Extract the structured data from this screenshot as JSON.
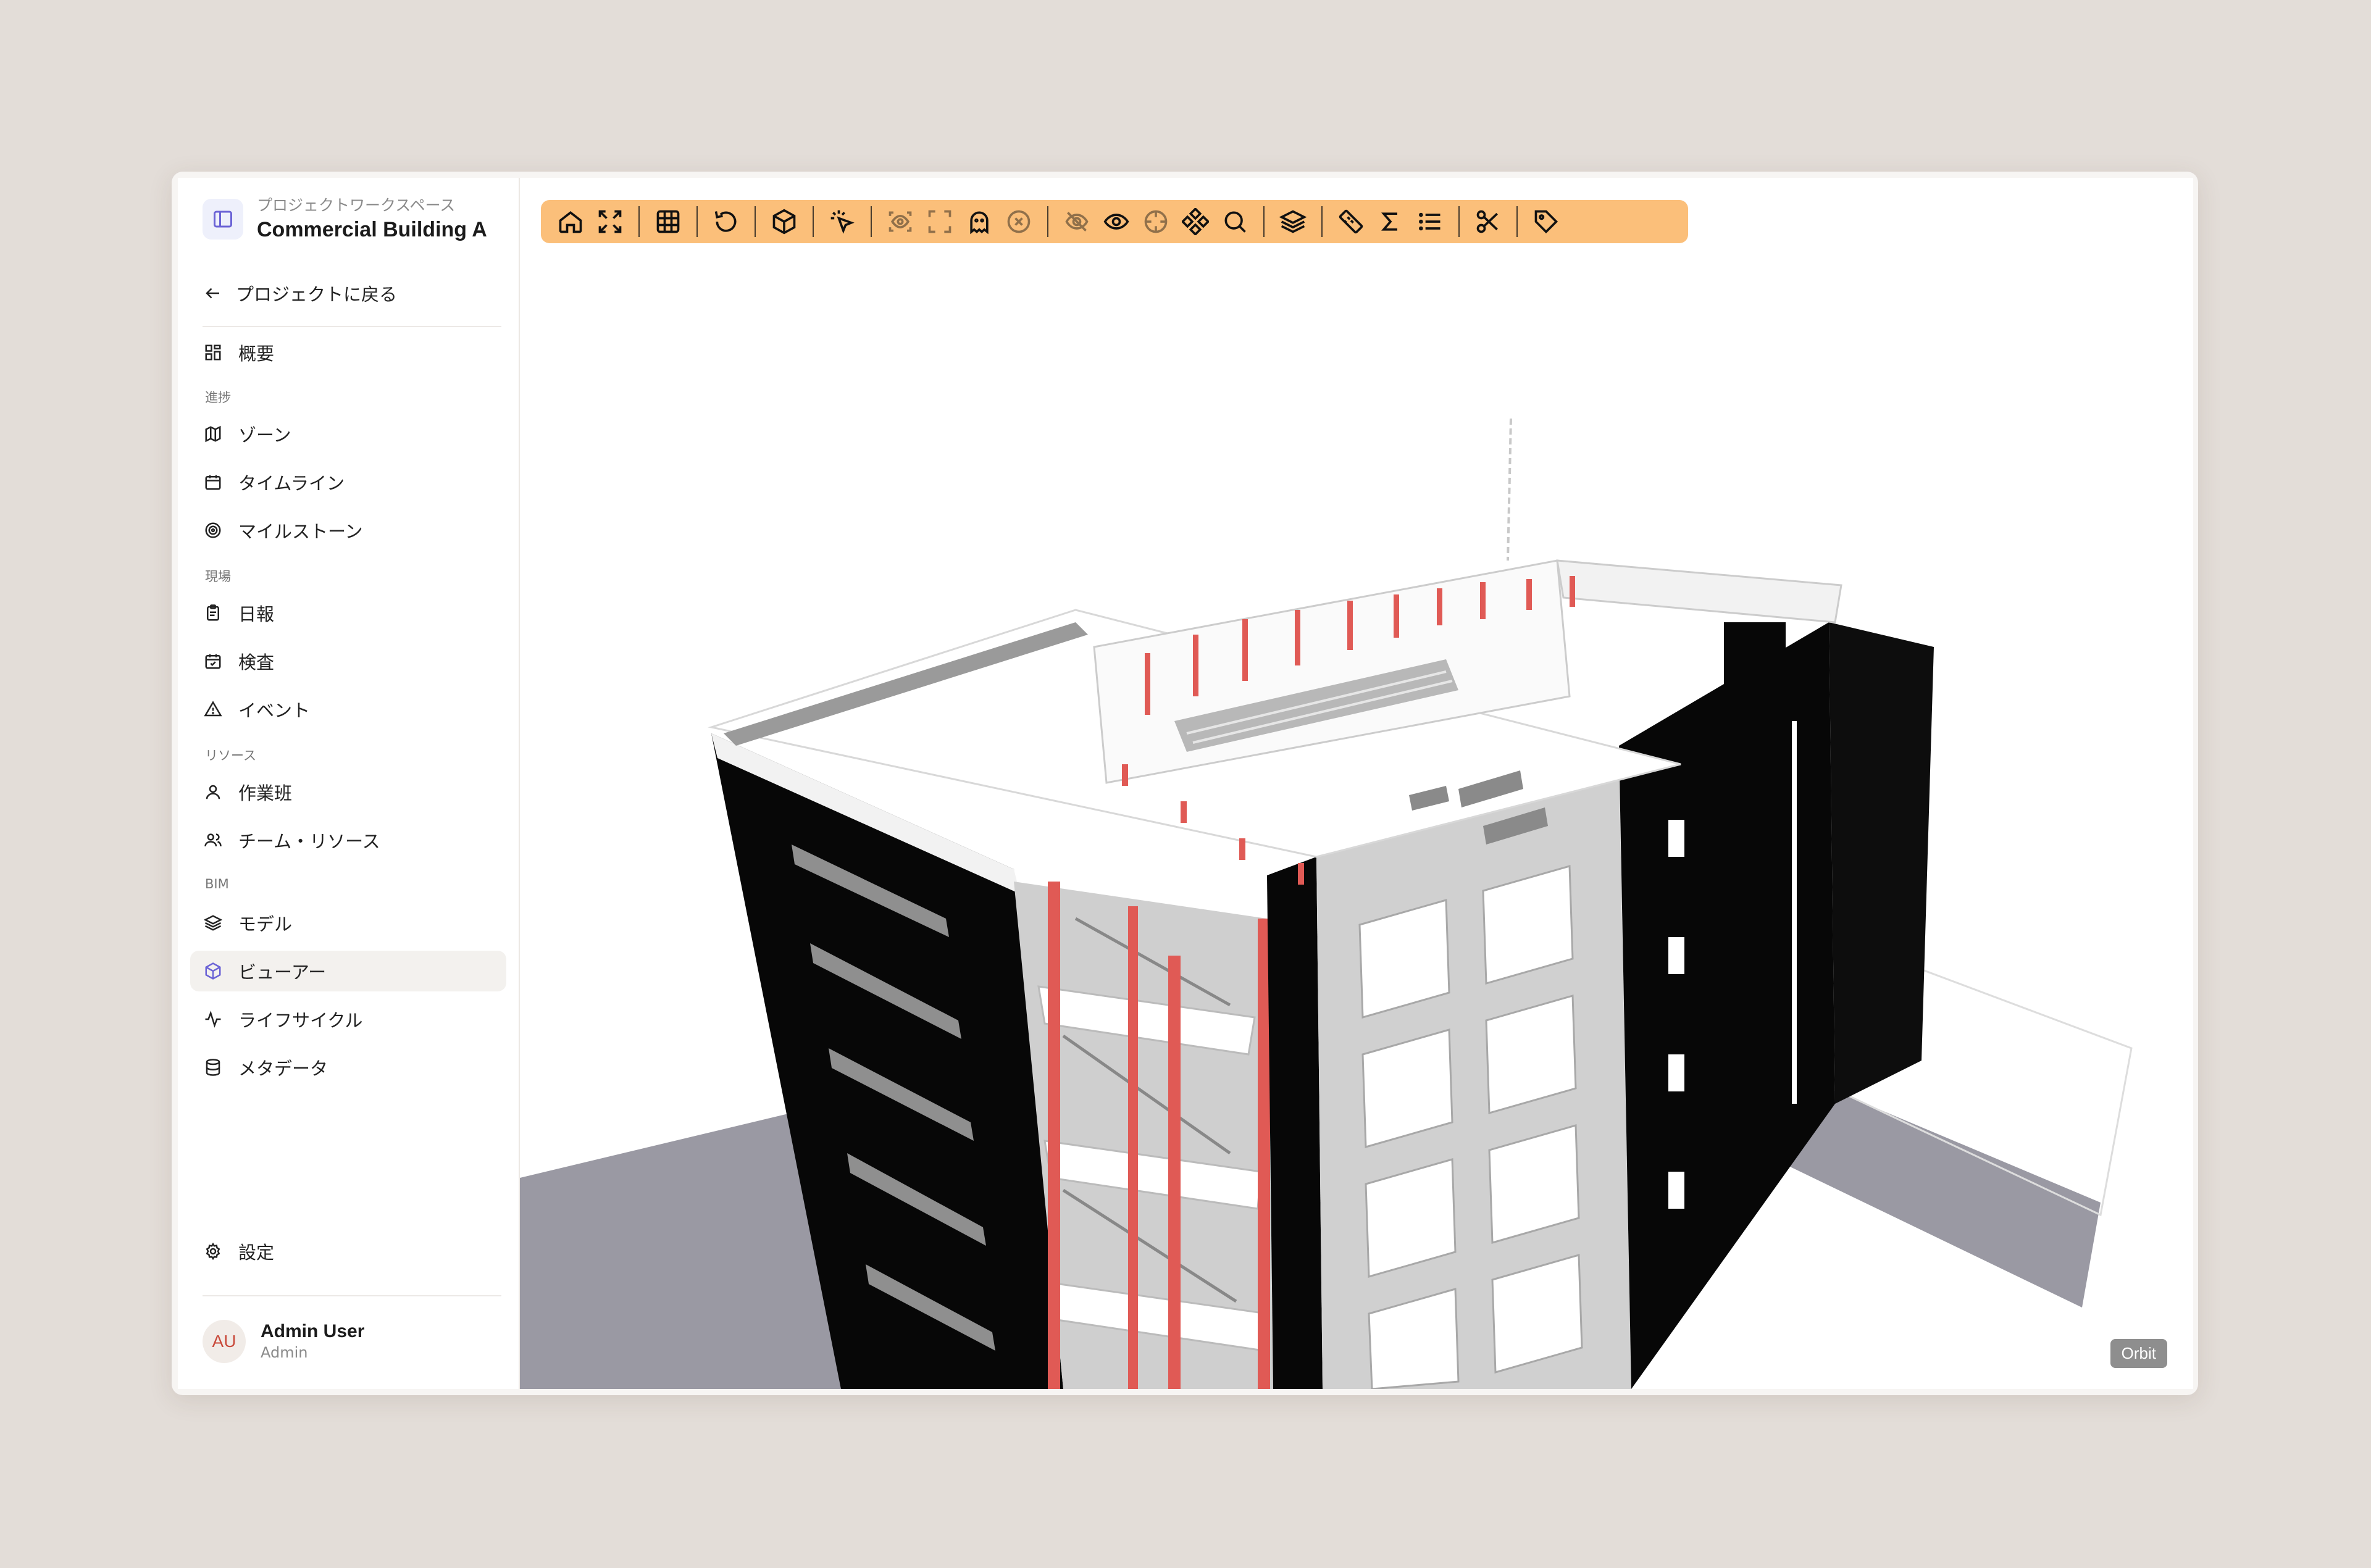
{
  "workspace": {
    "label": "プロジェクトワークスペース",
    "title": "Commercial Building A",
    "icon": "sidebar-panel-icon"
  },
  "back": {
    "label": "プロジェクトに戻る",
    "icon": "arrow-left-icon"
  },
  "nav": {
    "overview": "概要",
    "sections": {
      "progress": "進捗",
      "site": "現場",
      "resources": "リソース",
      "bim": "BIM"
    },
    "items": {
      "zones": "ゾーン",
      "timeline": "タイムライン",
      "milestones": "マイルストーン",
      "daily_reports": "日報",
      "inspections": "検査",
      "events": "イベント",
      "crews": "作業班",
      "team_resources": "チーム・リソース",
      "models": "モデル",
      "viewer": "ビューアー",
      "lifecycle": "ライフサイクル",
      "metadata": "メタデータ"
    },
    "active": "viewer",
    "settings": "設定"
  },
  "user": {
    "initials": "AU",
    "name": "Admin User",
    "role": "Admin"
  },
  "toolbar": {
    "background": "#fbbf7a",
    "icons": [
      "home-icon",
      "fit-view-icon",
      "grid-icon",
      "reset-rotate-icon",
      "cube-icon",
      "select-pointer-icon",
      "focus-eye-icon",
      "frame-icon",
      "ghost-icon",
      "clear-icon",
      "hide-icon",
      "show-icon",
      "isolate-target-icon",
      "explode-icon",
      "search-icon",
      "layers-icon",
      "measure-ruler-icon",
      "sum-icon",
      "list-icon",
      "section-cut-icon",
      "tag-icon"
    ]
  },
  "viewer": {
    "mode": "Orbit"
  },
  "colors": {
    "accent": "#6b63d6",
    "structure_red": "#e05a55",
    "facade_dark": "#0a0a0a"
  }
}
